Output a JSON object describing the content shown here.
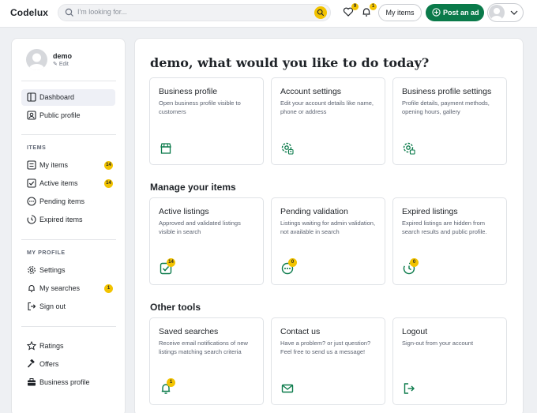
{
  "header": {
    "logo": "Codelux",
    "search_placeholder": "I'm looking for...",
    "favorites_count": "9",
    "notifications_count": "1",
    "my_items_label": "My items",
    "post_ad_label": "Post an ad"
  },
  "sidebar": {
    "username": "demo",
    "edit_label": "Edit",
    "nav": [
      {
        "label": "Dashboard"
      },
      {
        "label": "Public profile"
      }
    ],
    "items_heading": "ITEMS",
    "items": [
      {
        "label": "My items",
        "badge": "14"
      },
      {
        "label": "Active items",
        "badge": "14"
      },
      {
        "label": "Pending items"
      },
      {
        "label": "Expired items"
      }
    ],
    "profile_heading": "MY PROFILE",
    "profile_items": [
      {
        "label": "Settings"
      },
      {
        "label": "My searches",
        "badge": "1"
      },
      {
        "label": "Sign out"
      }
    ],
    "extra_items": [
      {
        "label": "Ratings"
      },
      {
        "label": "Offers"
      },
      {
        "label": "Business profile"
      }
    ]
  },
  "main": {
    "greeting": "demo, what would you like to do today?",
    "top_cards": [
      {
        "title": "Business profile",
        "desc": "Open business profile visible to customers",
        "icon": "store-icon"
      },
      {
        "title": "Account settings",
        "desc": "Edit your account details like name, phone or address",
        "icon": "user-gear-icon"
      },
      {
        "title": "Business profile settings",
        "desc": "Profile details, payment methods, opening hours, gallery",
        "icon": "store-gear-icon"
      }
    ],
    "manage_title": "Manage your items",
    "manage_cards": [
      {
        "title": "Active listings",
        "desc": "Approved and validated listings visible in search",
        "badge": "14",
        "icon": "checkbox-icon"
      },
      {
        "title": "Pending validation",
        "desc": "Listings waiting for admin validation, not available in search",
        "badge": "0",
        "icon": "pending-icon"
      },
      {
        "title": "Expired listings",
        "desc": "Expired listings are hidden from search results and public profile.",
        "badge": "0",
        "icon": "expired-icon"
      }
    ],
    "tools_title": "Other tools",
    "tools_cards": [
      {
        "title": "Saved searches",
        "desc": "Receive email notifications of new listings matching search criteria",
        "badge": "1",
        "icon": "bell-icon"
      },
      {
        "title": "Contact us",
        "desc": "Have a problem? or just question? Feel free to send us a message!",
        "icon": "mail-icon"
      },
      {
        "title": "Logout",
        "desc": "Sign-out from your account",
        "icon": "logout-icon"
      }
    ]
  },
  "colors": {
    "accent_green": "#0a7a4a",
    "badge_yellow": "#f2c300"
  }
}
